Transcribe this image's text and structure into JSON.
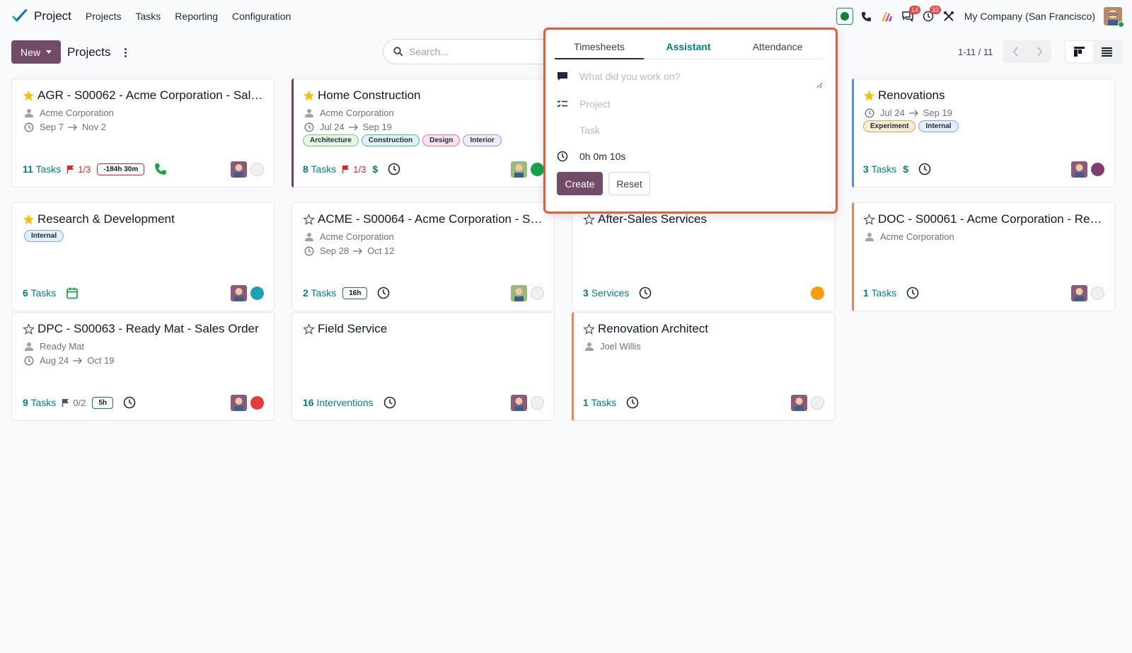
{
  "app": {
    "name": "Project",
    "menu": [
      "Projects",
      "Tasks",
      "Reporting",
      "Configuration"
    ],
    "company": "My Company (San Francisco)",
    "badges": {
      "messages": "14",
      "activities": "33"
    }
  },
  "control_panel": {
    "new_label": "New",
    "title": "Projects",
    "search_placeholder": "Search...",
    "pager": "1-11 / 11"
  },
  "timer": {
    "tabs": [
      "Timesheets",
      "Assistant",
      "Attendance"
    ],
    "description_placeholder": "What did you work on?",
    "project_placeholder": "Project",
    "task_placeholder": "Task",
    "time": "0h 0m 10s",
    "create_label": "Create",
    "reset_label": "Reset"
  },
  "cards": [
    {
      "title": "AGR - S00062 - Acme Corporation - Sal…",
      "customer": "Acme Corporation",
      "start": "Sep 7",
      "end": "Nov 2",
      "count": "11",
      "unit": "Tasks",
      "ratio": "1/3",
      "hours": "-184h 30m"
    },
    {
      "title": "Home Construction",
      "customer": "Acme Corporation",
      "start": "Jul 24",
      "end": "Sep 19",
      "tags": [
        "Architecture",
        "Construction",
        "Design",
        "Interior"
      ],
      "count": "8",
      "unit": "Tasks",
      "ratio": "1/3",
      "dollar": "$"
    },
    {
      "title": "Renovations",
      "start": "Jul 24",
      "end": "Sep 19",
      "tags": [
        "Experiment",
        "Internal"
      ],
      "count": "3",
      "unit": "Tasks",
      "dollar": "$"
    },
    {
      "title": "Research & Development",
      "tags": [
        "Internal"
      ],
      "count": "6",
      "unit": "Tasks"
    },
    {
      "title": "ACME - S00064 - Acme Corporation - S…",
      "customer": "Acme Corporation",
      "start": "Sep 28",
      "end": "Oct 12",
      "count": "2",
      "unit": "Tasks",
      "hours": "16h"
    },
    {
      "title": "After-Sales Services",
      "count": "3",
      "unit": "Services"
    },
    {
      "title": "DOC - S00061 - Acme Corporation - Re…",
      "customer": "Acme Corporation",
      "count": "1",
      "unit": "Tasks"
    },
    {
      "title": "DPC - S00063 - Ready Mat - Sales Order",
      "customer": "Ready Mat",
      "start": "Aug 24",
      "end": "Oct 19",
      "count": "9",
      "unit": "Tasks",
      "ratio": "0/2",
      "hours": "5h"
    },
    {
      "title": "Field Service",
      "count": "16",
      "unit": "Interventions"
    },
    {
      "title": "Renovation Architect",
      "customer": "Joel Willis",
      "count": "1",
      "unit": "Tasks"
    }
  ],
  "colors": {
    "primary": "#714b67",
    "teal": "#017e84",
    "popover_border": "#ea5a3a",
    "favorite_star": "#f3c30b",
    "state_teal": "#1aa3b8",
    "state_purple": "#7b3f6e",
    "state_orange": "#f59e0b",
    "state_red": "#e63b3b",
    "state_green": "#16a34a"
  },
  "icons": [
    "check-logo-icon",
    "star-icon",
    "person-icon",
    "clock-icon",
    "flag-icon",
    "phone-icon",
    "calendar-icon",
    "search-icon",
    "kanban-view-icon",
    "list-view-icon"
  ]
}
